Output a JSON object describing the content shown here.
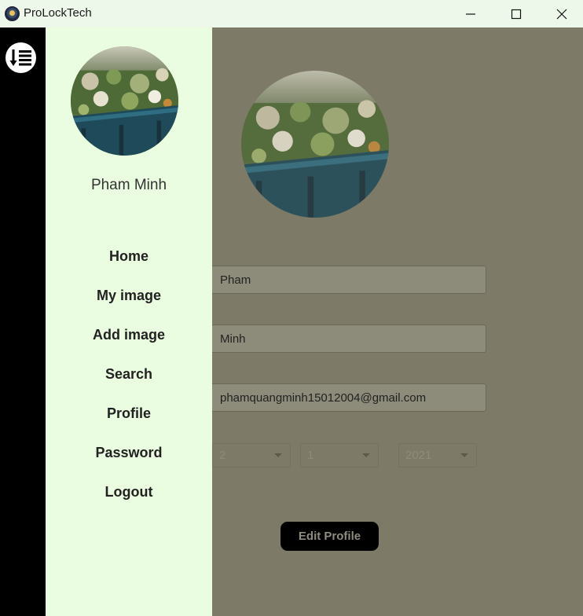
{
  "window": {
    "title": "ProLockTech"
  },
  "sidebar": {
    "user_name": "Pham Minh",
    "items": [
      {
        "label": "Home"
      },
      {
        "label": "My image"
      },
      {
        "label": "Add image"
      },
      {
        "label": "Search"
      },
      {
        "label": "Profile"
      },
      {
        "label": "Password"
      },
      {
        "label": "Logout"
      }
    ]
  },
  "profile": {
    "first_name": "Pham",
    "last_name": "Minh",
    "email": "phamquangminh15012004@gmail.com",
    "birth_day": "2",
    "birth_month": "1",
    "birth_year": "2021",
    "edit_label": "Edit Profile"
  },
  "colors": {
    "drawer_bg": "#ebfde0",
    "overlay": "#7d7b67",
    "button_bg": "#000000"
  }
}
